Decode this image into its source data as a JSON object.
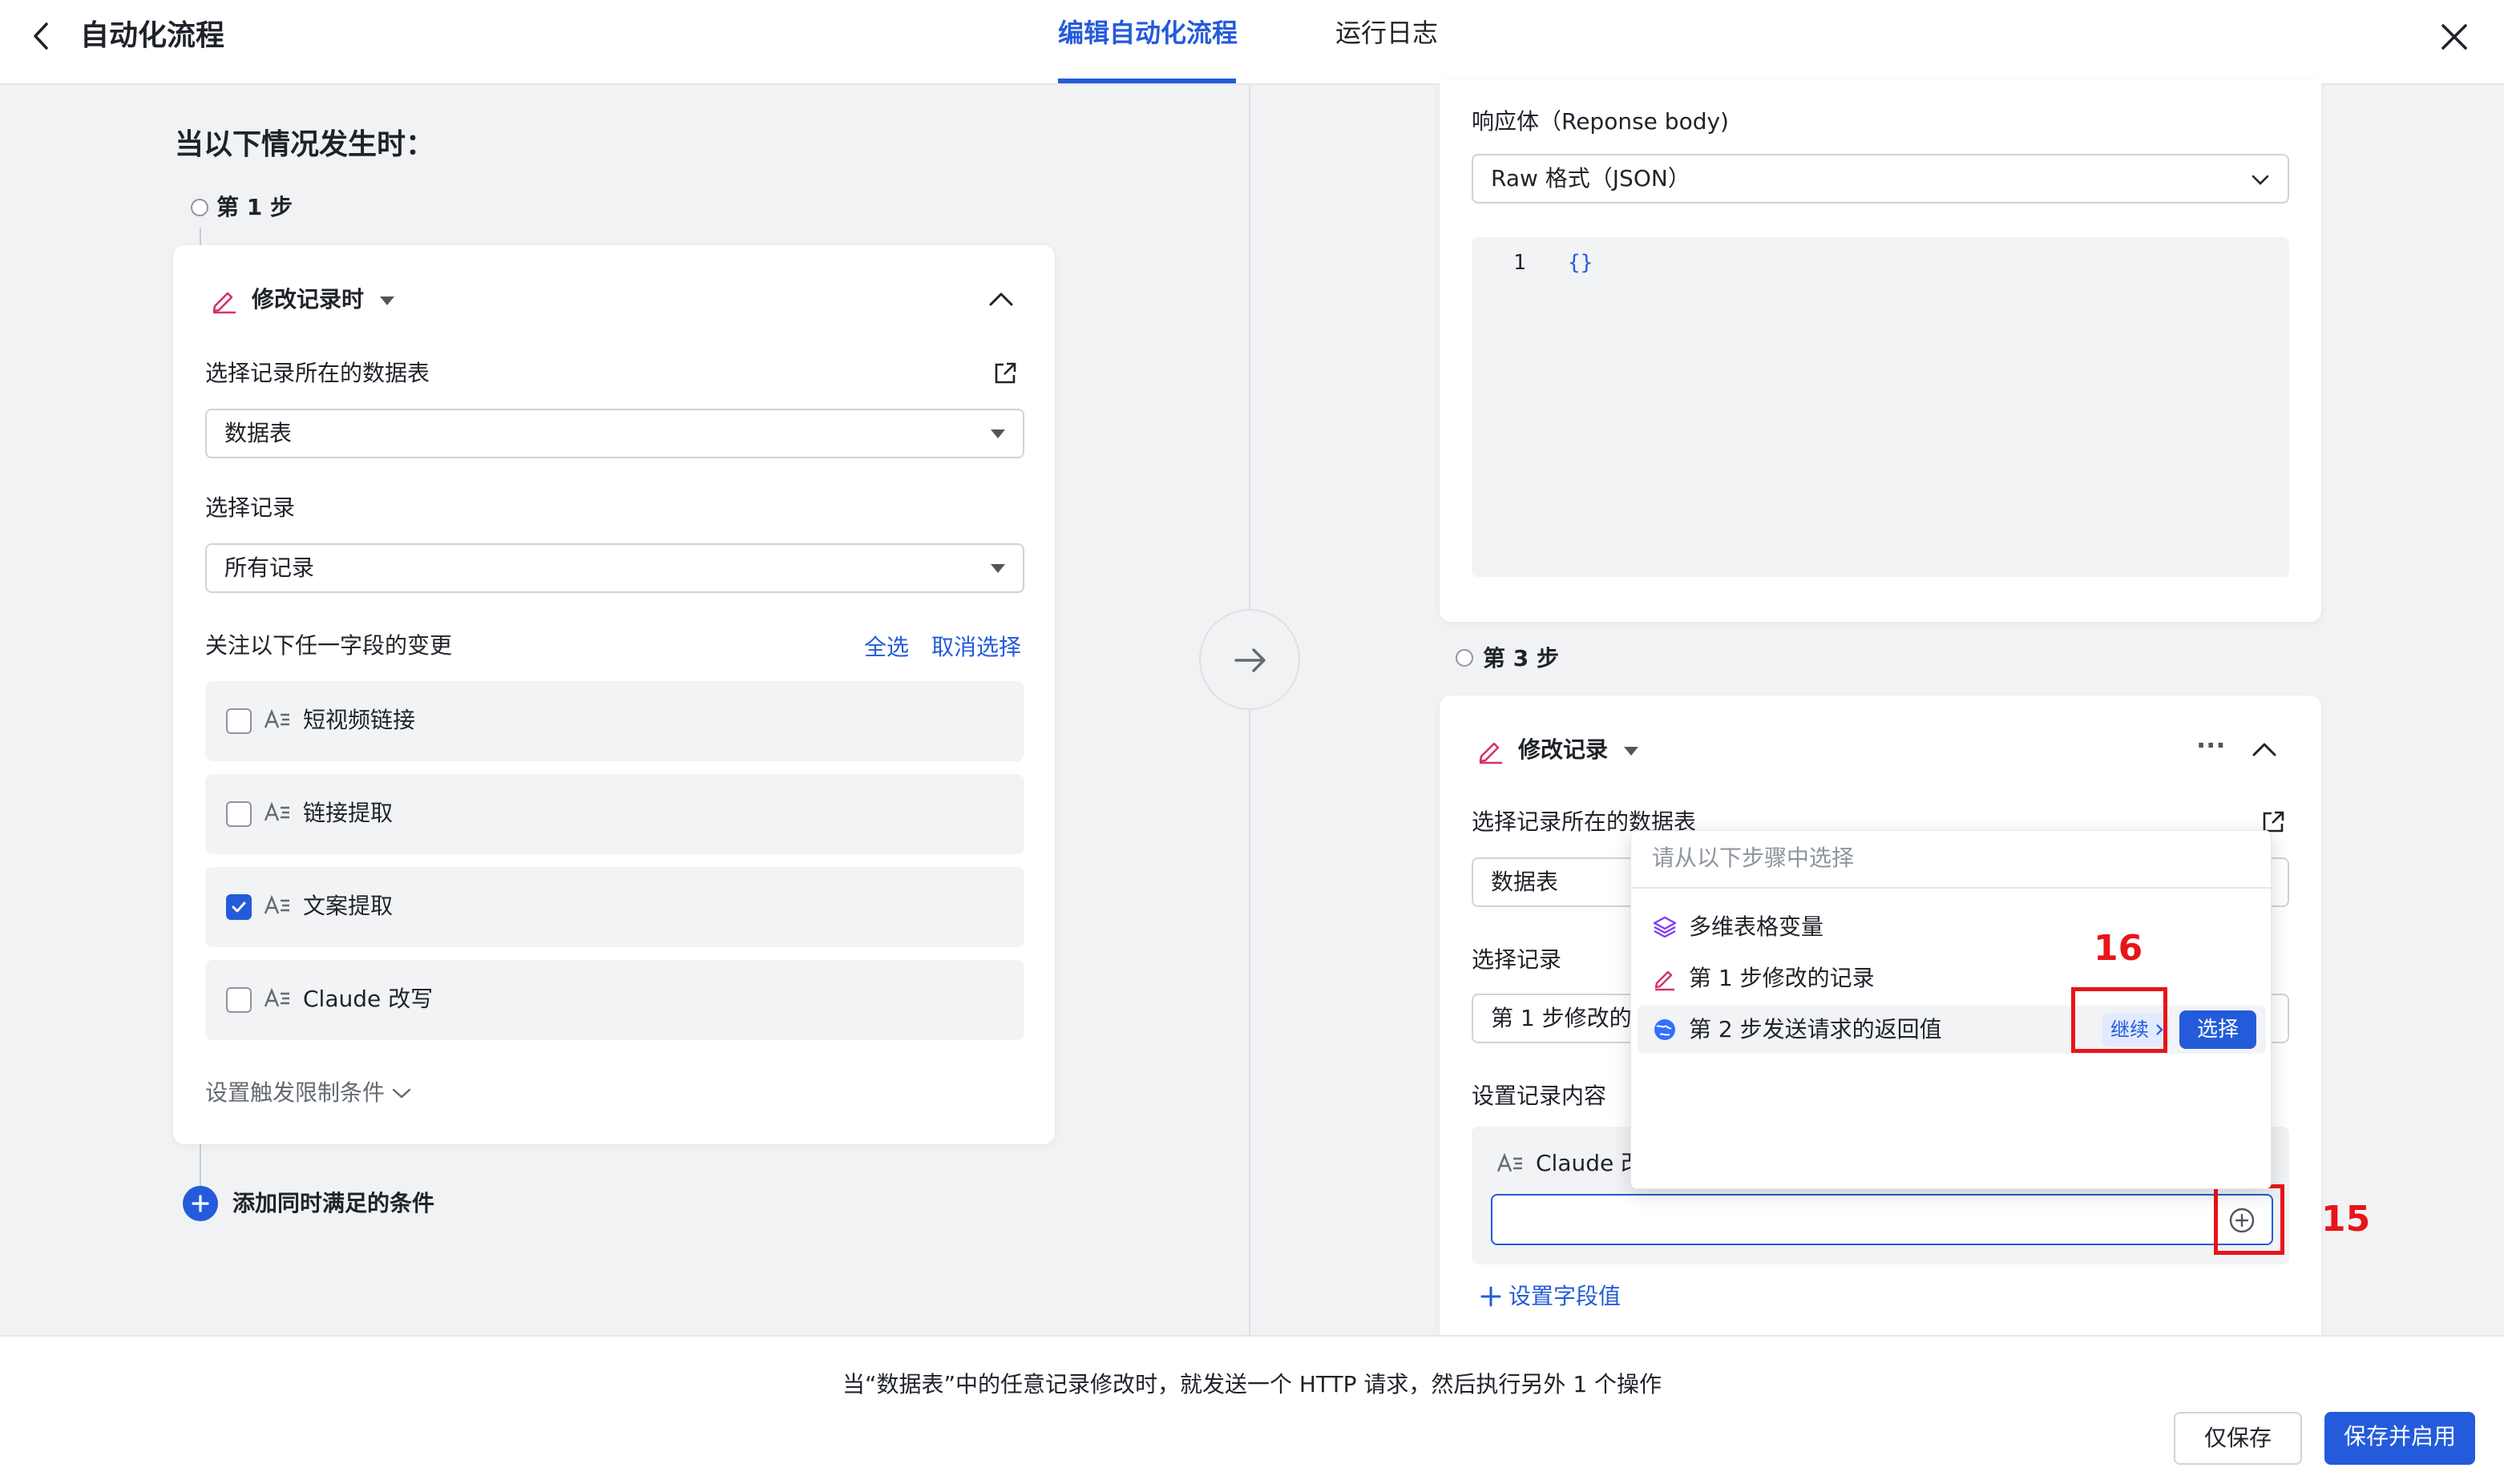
{
  "header": {
    "title": "自动化流程",
    "tabs": [
      {
        "label": "编辑自动化流程",
        "active": true
      },
      {
        "label": "运行日志",
        "active": false
      }
    ]
  },
  "left": {
    "section_title": "当以下情况发生时：",
    "step1_label": "第 1 步",
    "trigger": {
      "title": "修改记录时",
      "table_label": "选择记录所在的数据表",
      "table_value": "数据表",
      "record_label": "选择记录",
      "record_value": "所有记录",
      "watch_label": "关注以下任一字段的变更",
      "select_all": "全选",
      "deselect": "取消选择",
      "fields": [
        {
          "name": "短视频链接",
          "checked": false
        },
        {
          "name": "链接提取",
          "checked": false
        },
        {
          "name": "文案提取",
          "checked": true
        },
        {
          "name": "Claude 改写",
          "checked": false
        }
      ],
      "limit_conditions": "设置触发限制条件"
    },
    "add_condition": "添加同时满足的条件"
  },
  "right": {
    "response_label": "响应体（Reponse body)",
    "response_format": "Raw 格式（JSON）",
    "code_line_no": "1",
    "code_text": "{}",
    "step3_label": "第 3 步",
    "action": {
      "title": "修改记录",
      "more": "···",
      "table_label": "选择记录所在的数据表",
      "table_value": "数据表",
      "record_label": "选择记录",
      "record_value": "第 1 步修改的",
      "content_label": "设置记录内容",
      "field_name": "Claude 改",
      "set_field_value": "设置字段值"
    },
    "popup": {
      "placeholder": "请从以下步骤中选择",
      "items": [
        {
          "label": "多维表格变量",
          "icon": "layers-icon"
        },
        {
          "label": "第 1 步修改的记录",
          "icon": "pencil-icon"
        },
        {
          "label": "第 2 步发送请求的返回值",
          "icon": "globe-icon"
        }
      ],
      "continue_label": "继续",
      "select_label": "选择"
    },
    "annotations": {
      "n16": "16",
      "n15": "15"
    }
  },
  "footer": {
    "summary": "当“数据表”中的任意记录修改时，就发送一个 HTTP 请求，然后执行另外 1 个操作",
    "save_only": "仅保存",
    "save_enable": "保存并启用"
  },
  "colors": {
    "accent": "#245bdb",
    "annotation_red": "#e8141a",
    "pencil_pink": "#d6306f"
  }
}
